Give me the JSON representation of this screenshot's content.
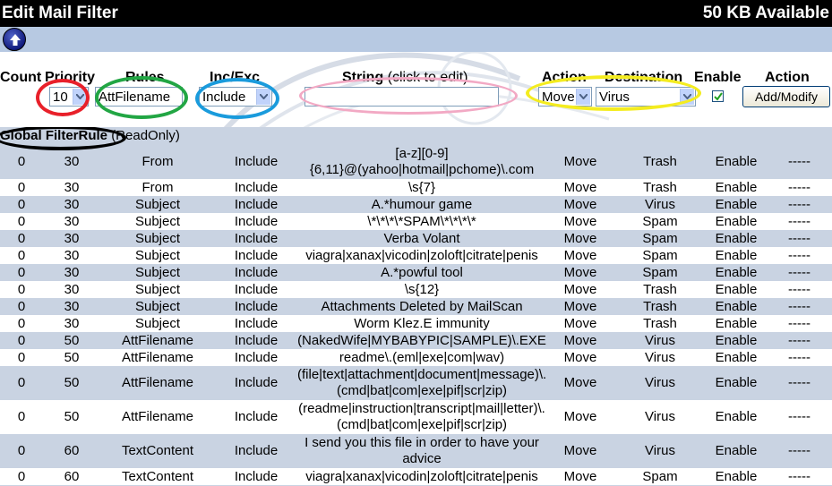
{
  "header": {
    "title": "Edit Mail Filter",
    "available": "50 KB Available"
  },
  "toolbar": {
    "up_icon": "up-arrow-circle-icon"
  },
  "columns": {
    "count": "Count",
    "priority": "Priority",
    "rules": "Rules",
    "inc_exc": "Inc/Exc",
    "string": "String",
    "string_hint": "(click to edit)",
    "action": "Action",
    "destination": "Destination",
    "enable": "Enable",
    "action2": "Action"
  },
  "form": {
    "priority_value": "10",
    "rule_value": "AttFilename",
    "incexc_value": "Include",
    "string_value": "",
    "action_value": "Move",
    "destination_value": "Virus",
    "enable_checked": true,
    "submit_label": "Add/Modify"
  },
  "highlight_colors": {
    "priority": "#e8202a",
    "rule": "#22a644",
    "incexc": "#1a9bdc",
    "string": "#f2a9c4",
    "action_destination": "#f4ec1f",
    "global_rule": "#000000"
  },
  "global": {
    "label": "Global FilterRule",
    "note": "(ReadOnly)"
  },
  "rows": [
    {
      "count": "0",
      "priority": "30",
      "rule": "From",
      "incexc": "Include",
      "string_lines": [
        "[a-z][0-9]",
        "{6,11}@(yahoo|hotmail|pchome)\\.com"
      ],
      "action": "Move",
      "destination": "Trash",
      "enable": "Enable",
      "op": "-----"
    },
    {
      "count": "0",
      "priority": "30",
      "rule": "From",
      "incexc": "Include",
      "string_lines": [
        "\\s{7}"
      ],
      "action": "Move",
      "destination": "Trash",
      "enable": "Enable",
      "op": "-----"
    },
    {
      "count": "0",
      "priority": "30",
      "rule": "Subject",
      "incexc": "Include",
      "string_lines": [
        "A.*humour game"
      ],
      "action": "Move",
      "destination": "Virus",
      "enable": "Enable",
      "op": "-----"
    },
    {
      "count": "0",
      "priority": "30",
      "rule": "Subject",
      "incexc": "Include",
      "string_lines": [
        "\\*\\*\\*\\*SPAM\\*\\*\\*\\*"
      ],
      "action": "Move",
      "destination": "Spam",
      "enable": "Enable",
      "op": "-----"
    },
    {
      "count": "0",
      "priority": "30",
      "rule": "Subject",
      "incexc": "Include",
      "string_lines": [
        "Verba Volant"
      ],
      "action": "Move",
      "destination": "Spam",
      "enable": "Enable",
      "op": "-----"
    },
    {
      "count": "0",
      "priority": "30",
      "rule": "Subject",
      "incexc": "Include",
      "string_lines": [
        "viagra|xanax|vicodin|zoloft|citrate|penis"
      ],
      "action": "Move",
      "destination": "Spam",
      "enable": "Enable",
      "op": "-----"
    },
    {
      "count": "0",
      "priority": "30",
      "rule": "Subject",
      "incexc": "Include",
      "string_lines": [
        "A.*powful tool"
      ],
      "action": "Move",
      "destination": "Spam",
      "enable": "Enable",
      "op": "-----"
    },
    {
      "count": "0",
      "priority": "30",
      "rule": "Subject",
      "incexc": "Include",
      "string_lines": [
        "\\s{12}"
      ],
      "action": "Move",
      "destination": "Trash",
      "enable": "Enable",
      "op": "-----"
    },
    {
      "count": "0",
      "priority": "30",
      "rule": "Subject",
      "incexc": "Include",
      "string_lines": [
        "Attachments Deleted by MailScan"
      ],
      "action": "Move",
      "destination": "Trash",
      "enable": "Enable",
      "op": "-----"
    },
    {
      "count": "0",
      "priority": "30",
      "rule": "Subject",
      "incexc": "Include",
      "string_lines": [
        "Worm Klez.E immunity"
      ],
      "action": "Move",
      "destination": "Trash",
      "enable": "Enable",
      "op": "-----"
    },
    {
      "count": "0",
      "priority": "50",
      "rule": "AttFilename",
      "incexc": "Include",
      "string_lines": [
        "(NakedWife|MYBABYPIC|SAMPLE)\\.EXE"
      ],
      "action": "Move",
      "destination": "Virus",
      "enable": "Enable",
      "op": "-----"
    },
    {
      "count": "0",
      "priority": "50",
      "rule": "AttFilename",
      "incexc": "Include",
      "string_lines": [
        "readme\\.(eml|exe|com|wav)"
      ],
      "action": "Move",
      "destination": "Virus",
      "enable": "Enable",
      "op": "-----"
    },
    {
      "count": "0",
      "priority": "50",
      "rule": "AttFilename",
      "incexc": "Include",
      "string_lines": [
        "(file|text|attachment|document|message)\\.",
        "(cmd|bat|com|exe|pif|scr|zip)"
      ],
      "action": "Move",
      "destination": "Virus",
      "enable": "Enable",
      "op": "-----"
    },
    {
      "count": "0",
      "priority": "50",
      "rule": "AttFilename",
      "incexc": "Include",
      "string_lines": [
        "(readme|instruction|transcript|mail|letter)\\.",
        "(cmd|bat|com|exe|pif|scr|zip)"
      ],
      "action": "Move",
      "destination": "Virus",
      "enable": "Enable",
      "op": "-----"
    },
    {
      "count": "0",
      "priority": "60",
      "rule": "TextContent",
      "incexc": "Include",
      "string_lines": [
        "I send you this file in order to have your",
        "advice"
      ],
      "action": "Move",
      "destination": "Virus",
      "enable": "Enable",
      "op": "-----"
    },
    {
      "count": "0",
      "priority": "60",
      "rule": "TextContent",
      "incexc": "Include",
      "string_lines": [
        "viagra|xanax|vicodin|zoloft|citrate|penis"
      ],
      "action": "Move",
      "destination": "Spam",
      "enable": "Enable",
      "op": "-----"
    }
  ]
}
